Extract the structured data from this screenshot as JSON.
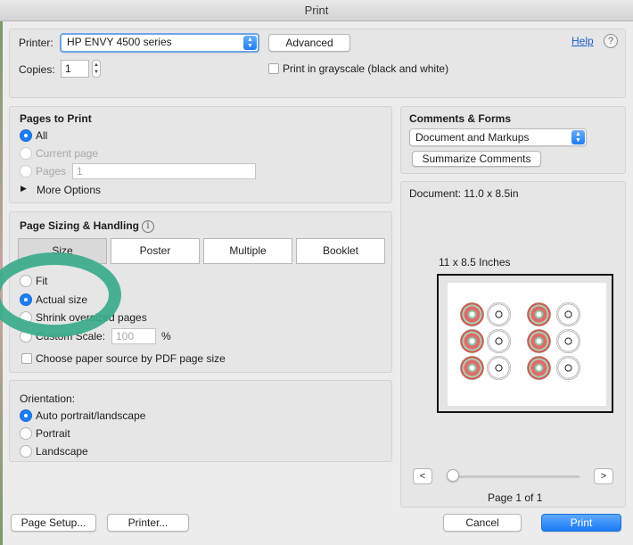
{
  "window": {
    "title": "Print"
  },
  "printer": {
    "label": "Printer:",
    "selected": "HP ENVY 4500 series",
    "advanced": "Advanced",
    "help": "Help",
    "help_icon": "?",
    "copies_label": "Copies:",
    "copies_value": "1",
    "grayscale_label": "Print in grayscale (black and white)",
    "grayscale_checked": false
  },
  "pages_to_print": {
    "title": "Pages to Print",
    "all": "All",
    "current": "Current page",
    "pages": "Pages",
    "pages_value": "1",
    "more": "More Options",
    "selected": "All"
  },
  "comments": {
    "title": "Comments & Forms",
    "selected": "Document and Markups",
    "summarize": "Summarize Comments"
  },
  "sizing": {
    "title": "Page Sizing & Handling",
    "info_icon": "i",
    "tabs": [
      "Size",
      "Poster",
      "Multiple",
      "Booklet"
    ],
    "active_tab": "Size",
    "options": [
      "Fit",
      "Actual size",
      "Shrink oversized pages",
      "Custom Scale:"
    ],
    "selected": "Actual size",
    "custom_scale_value": "100",
    "percent": "%",
    "pdf_source_label": "Choose paper source by PDF page size"
  },
  "orientation": {
    "title": "Orientation:",
    "options": [
      "Auto portrait/landscape",
      "Portrait",
      "Landscape"
    ],
    "selected": "Auto portrait/landscape"
  },
  "preview": {
    "document_size": "Document: 11.0 x 8.5in",
    "paper_label": "11 x 8.5 Inches",
    "prev": "<",
    "next": ">",
    "page_status": "Page 1 of 1",
    "page_progress": 0
  },
  "footer": {
    "page_setup": "Page Setup...",
    "printer": "Printer...",
    "cancel": "Cancel",
    "print": "Print"
  },
  "colors": {
    "accent": "#1b7cf3",
    "annotation": "#3aab8c"
  }
}
